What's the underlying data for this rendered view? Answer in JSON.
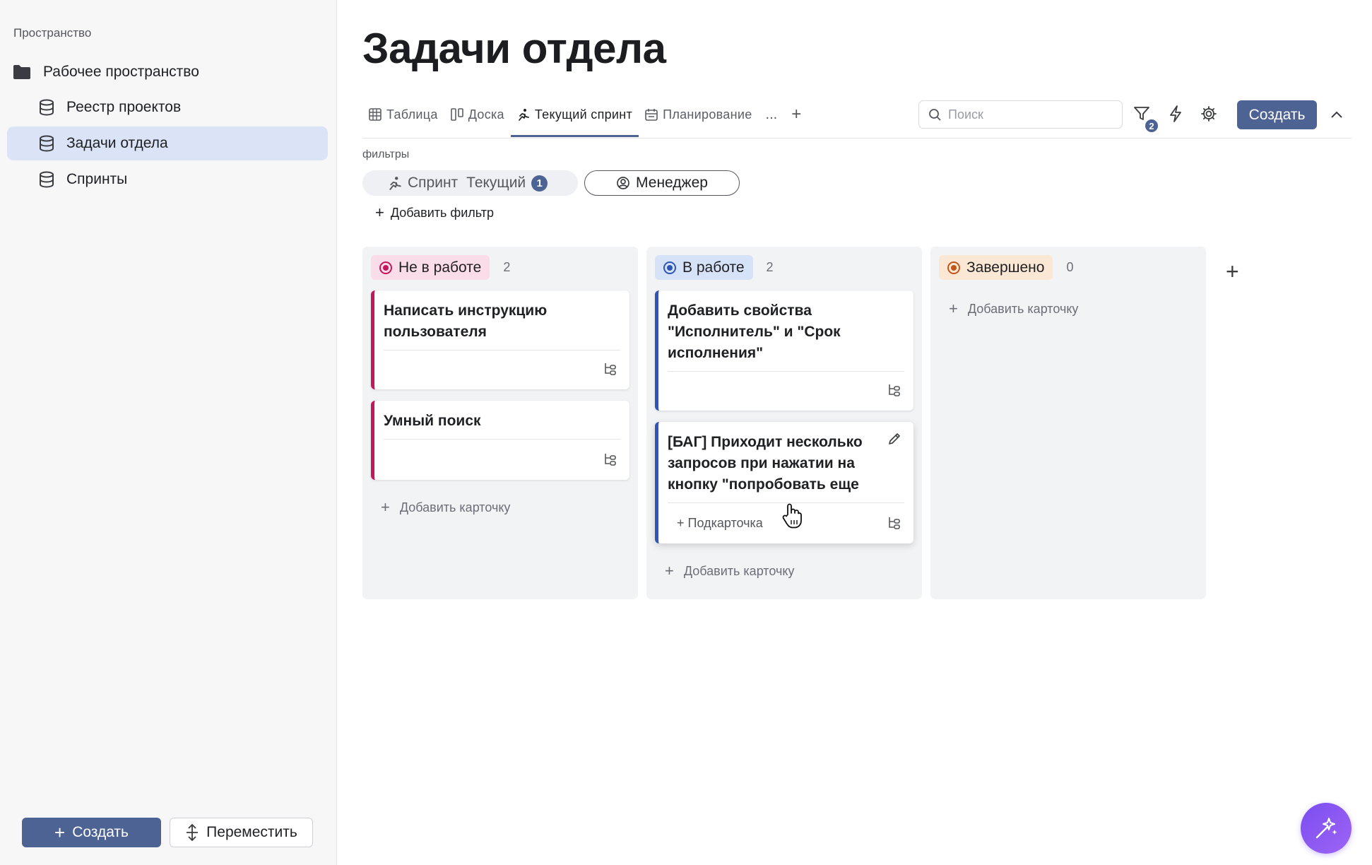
{
  "sidebar": {
    "section_label": "Пространство",
    "workspace": "Рабочее пространство",
    "items": [
      {
        "label": "Реестр проектов"
      },
      {
        "label": "Задачи отдела"
      },
      {
        "label": "Спринты"
      }
    ],
    "create_label": "Создать",
    "move_label": "Переместить"
  },
  "header": {
    "title": "Задачи отдела"
  },
  "tabs": [
    {
      "label": "Таблица",
      "icon": "table-icon"
    },
    {
      "label": "Доска",
      "icon": "board-icon"
    },
    {
      "label": "Текущий спринт",
      "icon": "running-icon"
    },
    {
      "label": "Планирование",
      "icon": "planning-icon"
    }
  ],
  "tabs_more": "...",
  "tabs_add": "+",
  "toolbar": {
    "search_placeholder": "Поиск",
    "filter_count": "2",
    "create_label": "Создать"
  },
  "filters": {
    "label": "фильтры",
    "sprint_chip": {
      "name": "Спринт",
      "value": "Текущий",
      "badge": "1"
    },
    "manager_chip": "Менеджер",
    "add_label": "Добавить фильтр"
  },
  "board": {
    "columns": [
      {
        "status": "Не в работе",
        "count": "2",
        "color": "#c2185b",
        "bg": "#fbdce9",
        "cards": [
          {
            "title": "Написать инструкцию пользователя"
          },
          {
            "title": "Умный поиск"
          }
        ],
        "add_label": "Добавить карточку"
      },
      {
        "status": "В работе",
        "count": "2",
        "color": "#2f55b5",
        "bg": "#d6e2f7",
        "cards": [
          {
            "title": "Добавить свойства \"Исполнитель\" и \"Срок исполнения\""
          },
          {
            "title": "[БАГ] Приходит несколько запросов при нажатии на кнопку \"попробовать еще",
            "subcard_label": "+ Подкарточка"
          }
        ],
        "add_label": "Добавить карточку"
      },
      {
        "status": "Завершено",
        "count": "0",
        "color": "#c2561a",
        "bg": "#fbe8d4",
        "cards": [],
        "add_label": "Добавить карточку"
      }
    ],
    "add_column": "+"
  }
}
